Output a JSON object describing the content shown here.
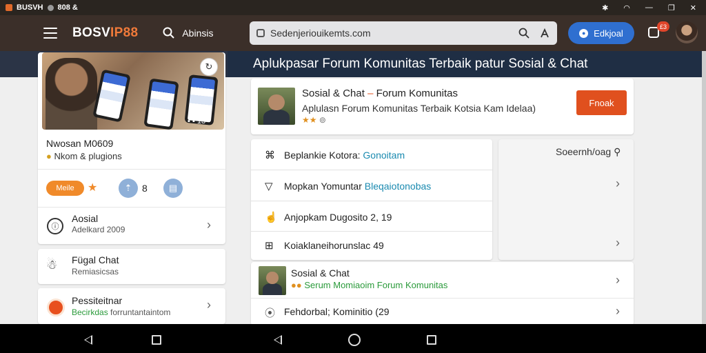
{
  "status_bar": {
    "left_text": "BUSVH",
    "left_text2": "808 &"
  },
  "app": {
    "logo_main": "BOSV",
    "logo_accent": "IP88",
    "search_label": "Abinsis"
  },
  "url_bar": {
    "url": "Sedenjeriouikemts.com"
  },
  "header": {
    "login_label": "Edkjoal",
    "notification_count": "£3"
  },
  "hero": {
    "title": "Aplukpasar Forum Komunitas Terbaik patur Sosial & Chat"
  },
  "left": {
    "photo_count": "13",
    "profile_name": "Nwosan M0609",
    "profile_subtitle": "Nkom & plugions",
    "pill_label": "Meile",
    "number_label": "8",
    "items": [
      {
        "title": "Aosial",
        "subtitle": "Adelkard 2009"
      },
      {
        "title": "Fügal Chat",
        "subtitle": "Remiasicsas"
      },
      {
        "title": "Pessiteitnar",
        "subtitle_green": "Becirkdas",
        "subtitle": "forruntantaintom"
      }
    ]
  },
  "center": {
    "top_card": {
      "title": "Sosial & Chat",
      "title_dash": "–",
      "title_suffix": "Forum Komunitas",
      "description": "Aplulasn Forum Komunitas Terbaik Kotsia Kam Idelaa)",
      "follow_label": "Fnoak"
    },
    "list": [
      {
        "label": "Beplankie Kotora:",
        "highlight": "Gonoitam"
      },
      {
        "label": "Mopkan Yomuntar",
        "highlight": "Bleqaiotonobas"
      },
      {
        "label": "Anjopkam Dugosito 2, 19",
        "highlight": ""
      },
      {
        "label": "Koiaklaneihorunslac 49",
        "highlight": ""
      }
    ],
    "bottom_card": {
      "title": "Sosial & Chat",
      "subtitle": "Serum Momiaoim Forum Komunitas",
      "location": "Fehdorbal; Kominitio (29"
    }
  },
  "right_panel": {
    "search_label": "Soeernh/oag"
  },
  "colors": {
    "header_bg": "#3b2f29",
    "hero_bg": "#1f2e44",
    "accent_orange": "#e0501e",
    "login_blue": "#2f6fd0"
  }
}
